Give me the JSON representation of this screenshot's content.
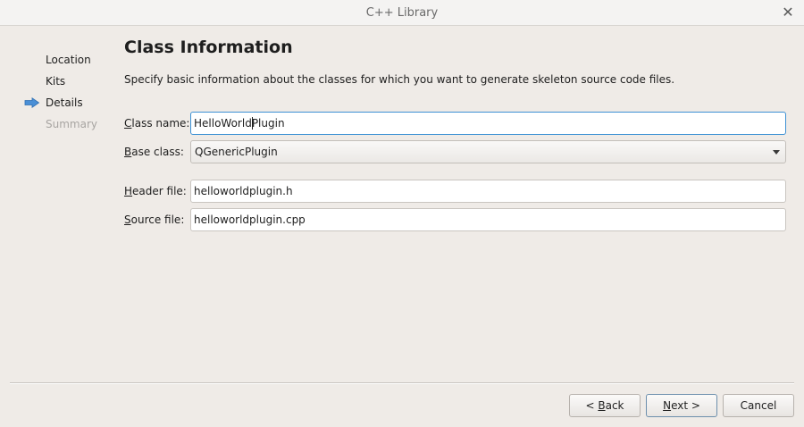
{
  "window": {
    "title": "C++ Library",
    "close_glyph": "✕"
  },
  "steps": [
    {
      "label": "Location",
      "state": "done"
    },
    {
      "label": "Kits",
      "state": "done"
    },
    {
      "label": "Details",
      "state": "current"
    },
    {
      "label": "Summary",
      "state": "pending"
    }
  ],
  "page": {
    "title": "Class Information",
    "subtitle": "Specify basic information about the classes for which you want to generate skeleton source code files."
  },
  "form": {
    "class_name": {
      "label_mnemonic": "C",
      "label_rest": "lass name:",
      "value_before_cursor": "HelloWorld",
      "value_after_cursor": "Plugin"
    },
    "base_class": {
      "label_mnemonic": "B",
      "label_rest": "ase class:",
      "value": "QGenericPlugin"
    },
    "header_file": {
      "label_mnemonic": "H",
      "label_rest": "eader file:",
      "value": "helloworldplugin.h"
    },
    "source_file": {
      "label_mnemonic": "S",
      "label_rest": "ource file:",
      "value": "helloworldplugin.cpp"
    }
  },
  "buttons": {
    "back": {
      "prefix": "< ",
      "mnemonic": "B",
      "rest": "ack"
    },
    "next": {
      "mnemonic": "N",
      "rest": "ext >"
    },
    "cancel": {
      "label": "Cancel"
    }
  },
  "colors": {
    "accent": "#3d91d4",
    "background": "#efebe7",
    "disabled_text": "#a8a5a2",
    "arrow": "#4a8fd6"
  },
  "icons": {
    "current_step": "arrow-right-icon",
    "combo": "chevron-down-icon",
    "close": "close-icon"
  }
}
